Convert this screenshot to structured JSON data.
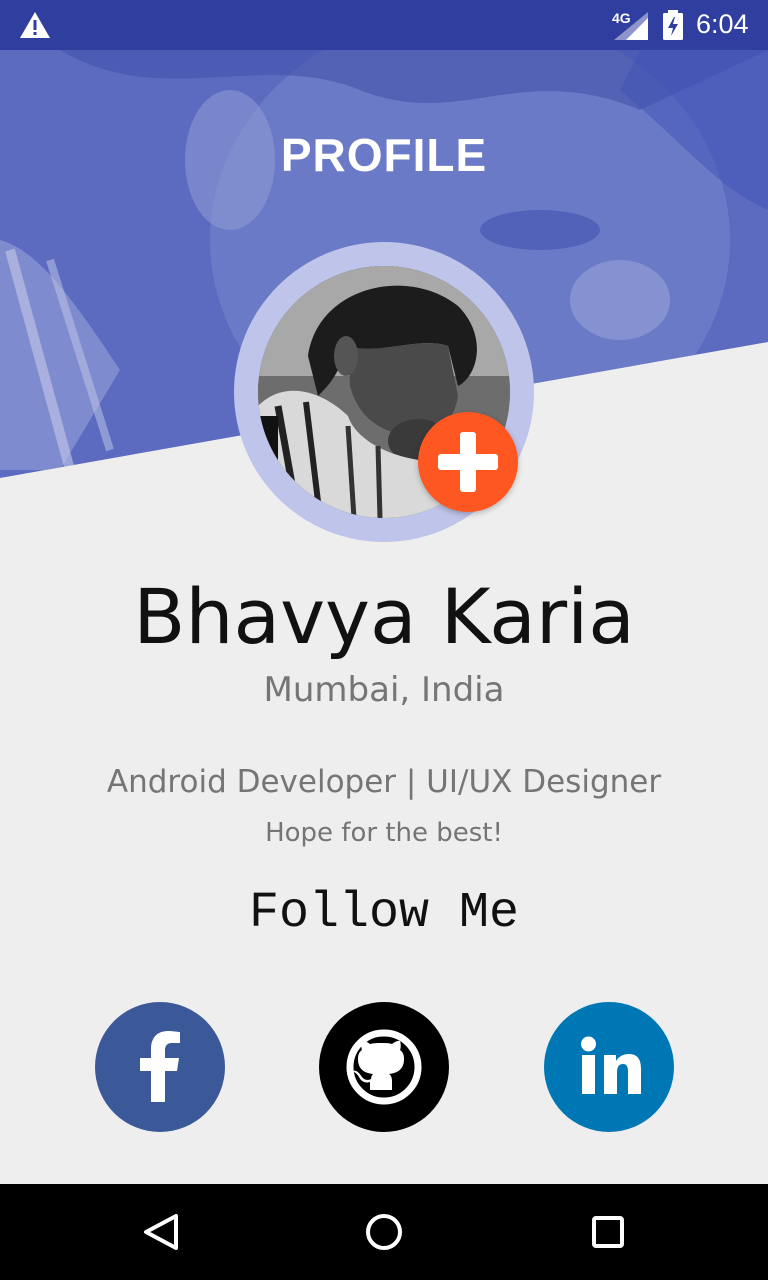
{
  "status_bar": {
    "network_label": "4G",
    "time": "6:04",
    "icons": [
      "warning-icon",
      "signal-icon",
      "battery-charging-icon"
    ]
  },
  "header": {
    "title": "PROFILE",
    "background_color": "#5c6bc0"
  },
  "profile": {
    "name": "Bhavya Karia",
    "location": "Mumbai, India",
    "role": "Android Developer | UI/UX Designer",
    "tagline": "Hope for the best!",
    "add_button_icon": "plus-icon",
    "add_button_color": "#ff5722"
  },
  "follow": {
    "title": "Follow Me",
    "links": [
      {
        "icon": "facebook-icon",
        "color": "#3b5998"
      },
      {
        "icon": "github-icon",
        "color": "#000000"
      },
      {
        "icon": "linkedin-icon",
        "color": "#0077b5"
      }
    ]
  },
  "nav_bar": {
    "icons": [
      "back-icon",
      "home-icon",
      "recents-icon"
    ]
  }
}
